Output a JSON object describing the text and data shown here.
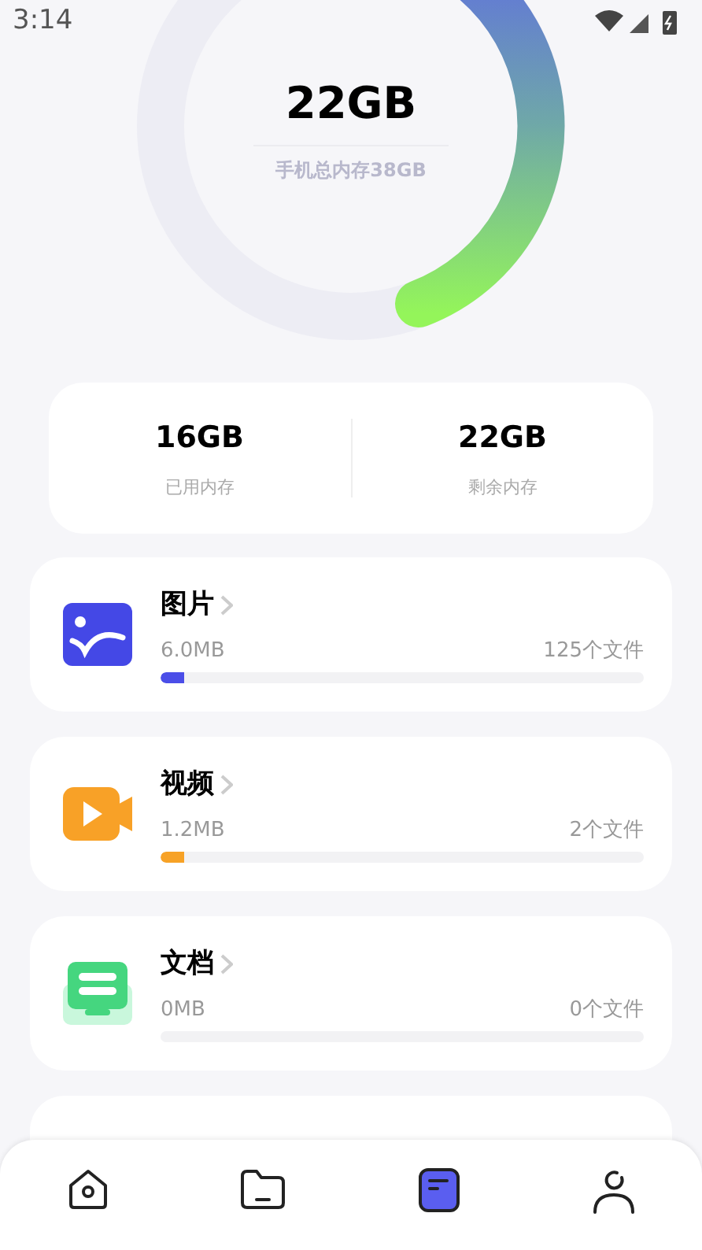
{
  "status_bar": {
    "time": "3:14"
  },
  "gauge": {
    "value": "22GB",
    "caption": "手机总内存38GB"
  },
  "summary": [
    {
      "value": "16GB",
      "label": "已用内存"
    },
    {
      "value": "22GB",
      "label": "剩余内存"
    }
  ],
  "categories": [
    {
      "kind": "image",
      "name": "图片",
      "size": "6.0MB",
      "count": "125个文件",
      "level": 0.05,
      "color": "#4b4ee8"
    },
    {
      "kind": "video",
      "name": "视频",
      "size": "1.2MB",
      "count": "2个文件",
      "level": 0.05,
      "color": "#f7a226"
    },
    {
      "kind": "document",
      "name": "文档",
      "size": "0MB",
      "count": "0个文件"
    }
  ],
  "nav": [
    {
      "kind": "home",
      "selected": false
    },
    {
      "kind": "folder",
      "selected": false
    },
    {
      "kind": "stats",
      "selected": true
    },
    {
      "kind": "user",
      "selected": false
    }
  ]
}
